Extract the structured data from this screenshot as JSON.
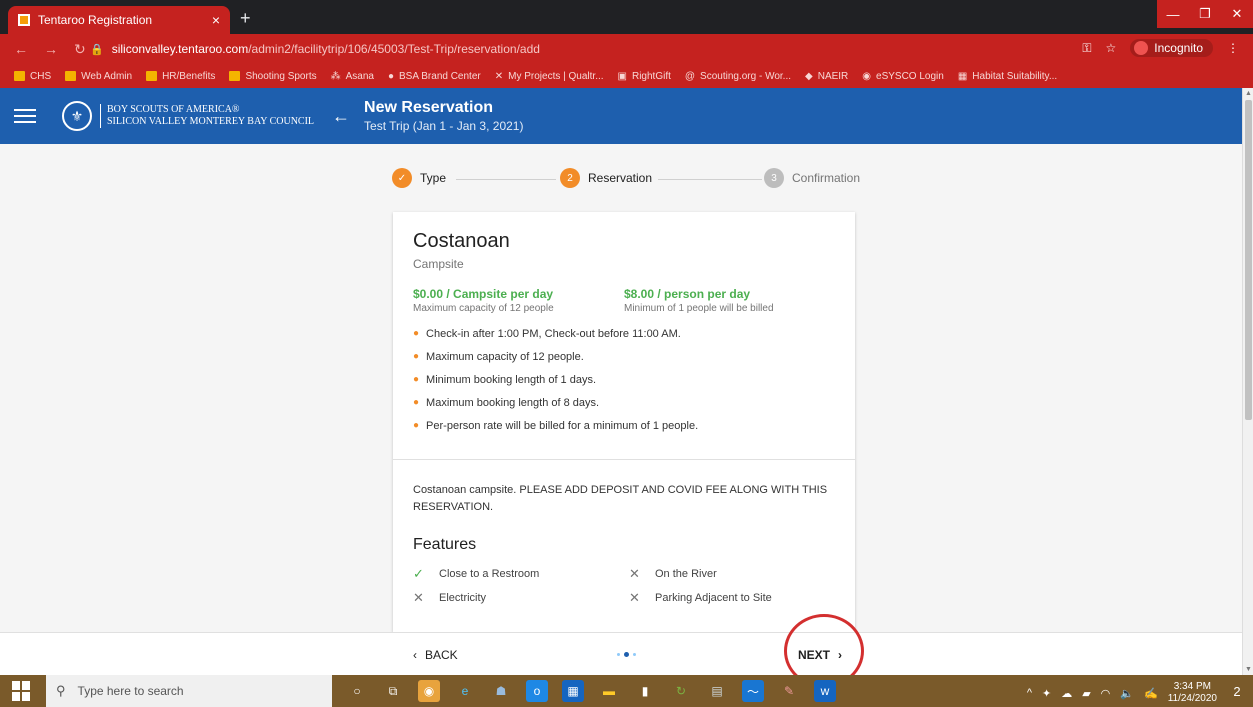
{
  "browser": {
    "tab_title": "Tentaroo Registration",
    "tab_close": "×",
    "new_tab": "+",
    "url_host": "siliconvalley.tentaroo.com",
    "url_path": "/admin2/facilitytrip/106/45003/Test-Trip/reservation/add",
    "incognito_label": "Incognito",
    "bookmarks": [
      "CHS",
      "Web Admin",
      "HR/Benefits",
      "Shooting Sports",
      "Asana",
      "BSA Brand Center",
      "My Projects | Qualtr...",
      "RightGift",
      "Scouting.org - Wor...",
      "NAEIR",
      "eSYSCO Login",
      "Habitat Suitability..."
    ]
  },
  "appbar": {
    "org_line1": "BOY SCOUTS OF AMERICA®",
    "org_line2": "SILICON VALLEY MONTEREY BAY COUNCIL",
    "title": "New Reservation",
    "subtitle": "Test Trip (Jan 1 - Jan 3, 2021)"
  },
  "stepper": {
    "steps": [
      {
        "label": "Type",
        "marker": "✓"
      },
      {
        "label": "Reservation",
        "marker": "2"
      },
      {
        "label": "Confirmation",
        "marker": "3"
      }
    ]
  },
  "site": {
    "name": "Costanoan",
    "type": "Campsite",
    "rates": [
      {
        "price": "$0.00 / Campsite per day",
        "note": "Maximum capacity of 12 people"
      },
      {
        "price": "$8.00 / person per day",
        "note": "Minimum of 1 people will be billed"
      }
    ],
    "rules": [
      "Check-in after 1:00 PM, Check-out before 11:00 AM.",
      "Maximum capacity of 12 people.",
      "Minimum booking length of 1 days.",
      "Maximum booking length of 8 days.",
      "Per-person rate will be billed for a minimum of 1 people."
    ],
    "description": "Costanoan campsite. PLEASE ADD DEPOSIT AND COVID FEE ALONG WITH THIS RESERVATION.",
    "features_title": "Features",
    "features": [
      {
        "label": "Close to a Restroom",
        "available": true
      },
      {
        "label": "On the River",
        "available": false
      },
      {
        "label": "Electricity",
        "available": false
      },
      {
        "label": "Parking Adjacent to Site",
        "available": false
      }
    ]
  },
  "nav": {
    "back_label": "BACK",
    "next_label": "NEXT"
  },
  "taskbar": {
    "search_placeholder": "Type here to search",
    "time": "3:34 PM",
    "date": "11/24/2020",
    "notifications": "2"
  },
  "colors": {
    "brand_blue": "#1e5fae",
    "chrome_red": "#c5221f",
    "accent_orange": "#f28c28",
    "rate_green": "#4caf50",
    "step_inactive": "#9e9e9e"
  }
}
